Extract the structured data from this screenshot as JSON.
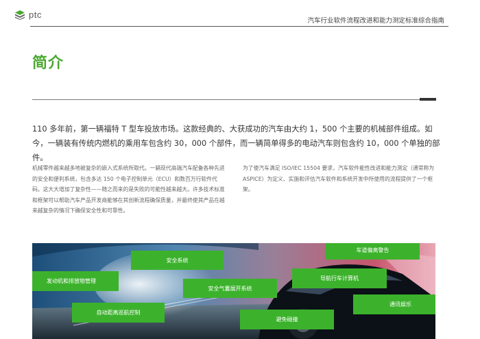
{
  "header": {
    "logo_text": "ptc",
    "doc_title": "汽车行业软件流程改进和能力测定标准综合指南"
  },
  "section": {
    "title": "简介"
  },
  "lead": "110 多年前，第一辆福特 T 型车投放市场。这款经典的、大获成功的汽车由大约 1，500 个主要的机械部件组成。如今，一辆装有传统内燃机的乘用车包含约 30，000 个部件，而一辆简单得多的电动汽车则包含约 10，000 个单独的部件。",
  "body": {
    "left": "机械零件越来越多地被复杂的嵌入式系统所取代。一辆现代高端汽车配备各种先进的安全和便利系统，包含多达 150 个电子控制单元（ECU）和数百万行软件代码。这大大增加了复杂性——随之而来的是失败的可能性越来越大。许多技术标准和框架可以帮助汽车产品开发商能够在其创新流程确保质量，并最终使其产品在越来越复杂的情况下确保安全性和可靠性。",
    "right": "为了使汽车满足 ISO/IEC 15504 要求，汽车软件能性改进和能力测定（通常称为 ASPICE）为定义、实施和评估汽车软件和系统开发中所使用的流程提供了一个框架。"
  },
  "banner": {
    "tags": [
      "安全系统",
      "车道偏离警告",
      "发动机和排放物管理",
      "导航行车计算机",
      "安全气囊展开系统",
      "通讯娱乐",
      "自动距离巡航控制",
      "避免碰撞"
    ]
  },
  "colors": {
    "accent_green": "#4aa82f",
    "tag_green": "#3cb22c"
  }
}
